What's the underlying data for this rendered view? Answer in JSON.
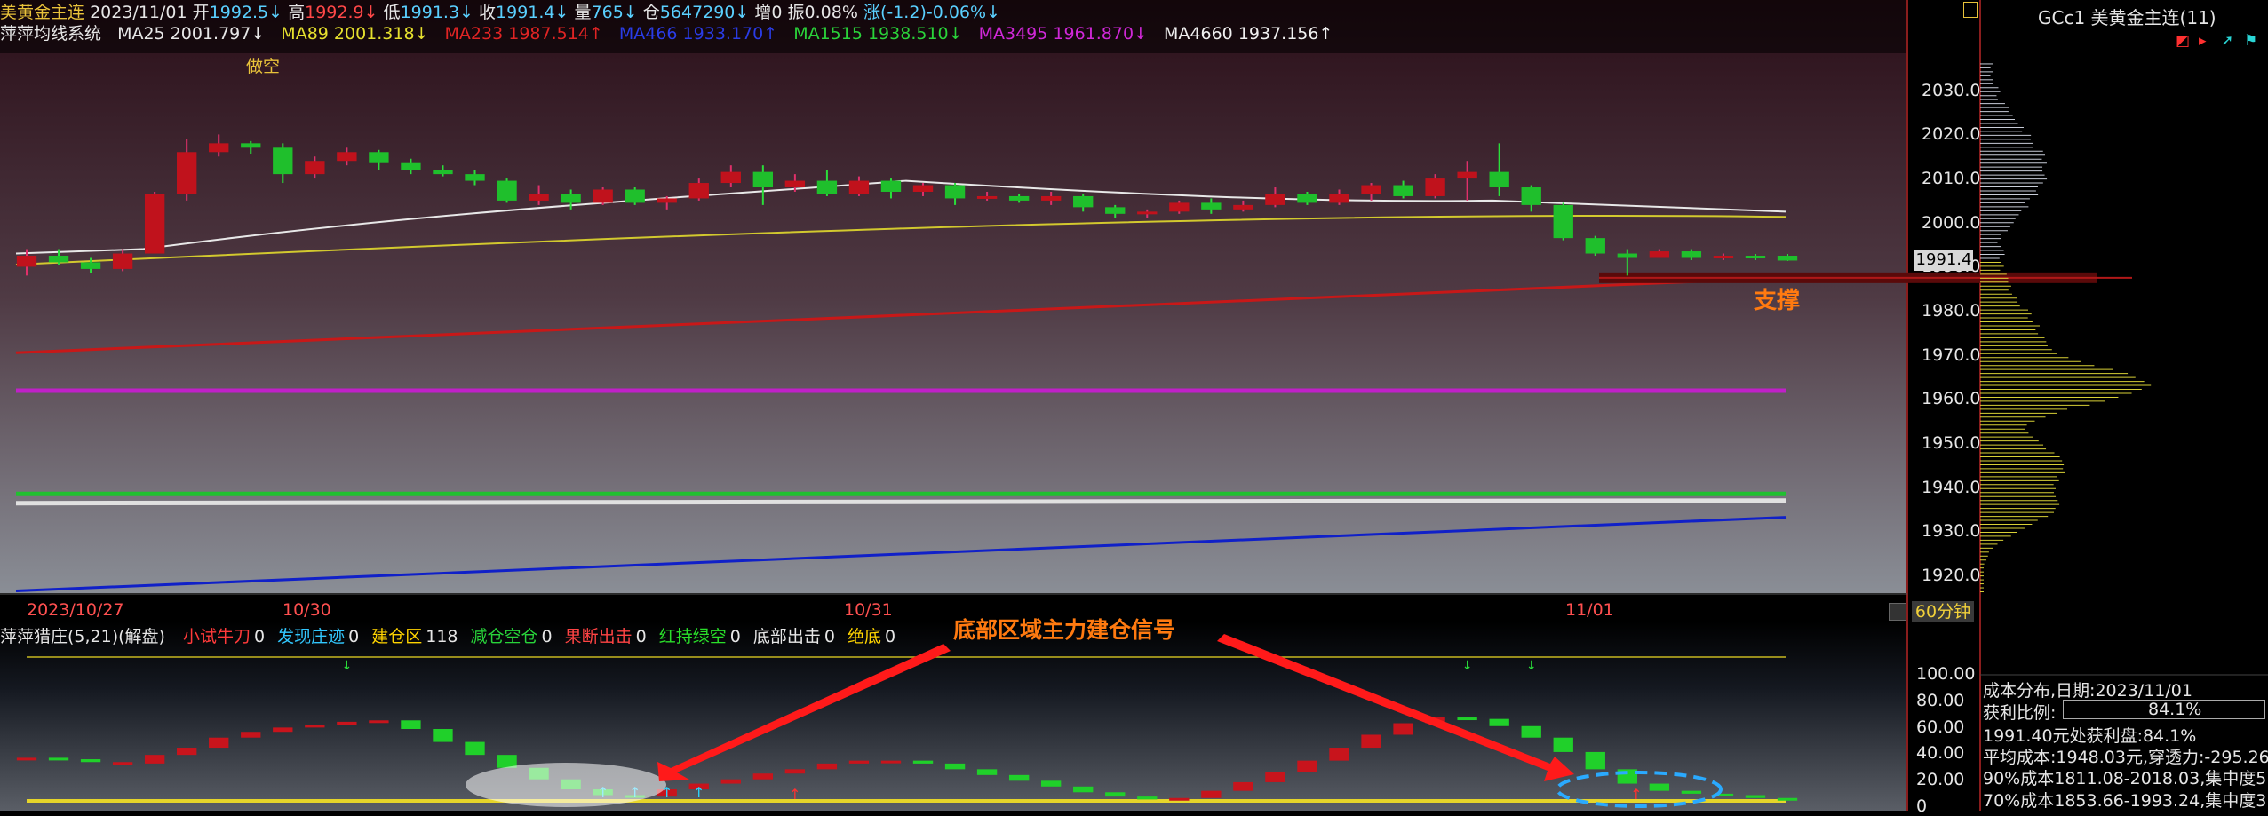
{
  "header": {
    "name": "美黄金主连",
    "date": "2023/11/01",
    "open_label": "开",
    "open": "1992.5",
    "high_label": "高",
    "high": "1992.9",
    "low_label": "低",
    "low": "1991.3",
    "close_label": "收",
    "close": "1991.4",
    "vol_label": "量",
    "vol": "765",
    "oi_label": "仓",
    "oi": "5647290",
    "inc_label": "增",
    "inc": "0",
    "amp_label": "振",
    "amp": "0.08%",
    "chg_label": "涨",
    "chg": "(-1.2)-0.06%",
    "arrow_down": "↓",
    "arrow_up": "↑"
  },
  "ma_line": {
    "title": "萍萍均线系统",
    "ma25": "MA25 2001.797↓",
    "ma89": "MA89 2001.318↓",
    "ma233": "MA233 1987.514↑",
    "ma466": "MA466 1933.170↑",
    "ma1515": "MA1515 1938.510↓",
    "ma3495": "MA3495 1961.870↓",
    "ma4660": "MA4660 1937.156↑"
  },
  "annotations": {
    "short": "做空",
    "support": "支撑",
    "signal": "底部区域主力建仓信号"
  },
  "price_axis": {
    "ticks": [
      "2030.0",
      "2020.0",
      "2010.0",
      "2000.0",
      "1990.0",
      "1980.0",
      "1970.0",
      "1960.0",
      "1950.0",
      "1940.0",
      "1930.0",
      "1920.0"
    ],
    "current": "1991.4"
  },
  "date_axis": {
    "labels": [
      "2023/10/27",
      "10/30",
      "10/31",
      "11/01"
    ],
    "period": "60分钟"
  },
  "indicator": {
    "title": "萍萍猎庄(5,21)(解盘)",
    "items": [
      {
        "label": "小试牛刀",
        "value": "0",
        "color": "#ff3a3a"
      },
      {
        "label": "发现庄迹",
        "value": "0",
        "color": "#32c8ff"
      },
      {
        "label": "建仓区",
        "value": "118",
        "color": "#ffd400"
      },
      {
        "label": "减仓空仓",
        "value": "0",
        "color": "#28d33a"
      },
      {
        "label": "果断出击",
        "value": "0",
        "color": "#ff4444"
      },
      {
        "label": "红持绿空",
        "value": "0",
        "color": "#2adf2a"
      },
      {
        "label": "底部出击",
        "value": "0",
        "color": "#e6e6e6"
      },
      {
        "label": "绝底",
        "value": "0",
        "color": "#ffd400"
      }
    ],
    "axis": [
      "100.00",
      "80.00",
      "60.00",
      "40.00",
      "20.00",
      "0"
    ]
  },
  "side_panel": {
    "title": "GCc1 美黄金主连(11)",
    "stats": [
      "成本分布,日期:2023/11/01",
      "获利比例:",
      "84.1%",
      "1991.40元处获利盘:84.1%",
      "平均成本:1948.03元,穿透力:-295.26",
      "90%成本1811.08-2018.03,集中度5.",
      "70%成本1853.66-1993.24,集中度3."
    ]
  },
  "colors": {
    "up": "#c0121c",
    "down": "#1fbf2c",
    "ma25": "#e8e8e8",
    "ma89": "#d2c92e",
    "ma233": "#c81818",
    "ma466": "#1020c8",
    "ma1515": "#20c030",
    "ma3495": "#c020c8",
    "ma4660": "#e0e0e0"
  },
  "chart_data": {
    "type": "candlestick",
    "x": [
      "10/27 a",
      "10/27 b",
      "10/27 c",
      "10/27 d",
      "10/30 a",
      "10/30 b",
      "10/30 c",
      "10/30 d",
      "10/30 e",
      "10/30 f",
      "10/30 g",
      "10/30 h",
      "10/30 i",
      "10/30 j",
      "10/30 k",
      "10/30 l",
      "10/30 m",
      "10/30 n",
      "10/30 o",
      "10/30 p",
      "10/30 q",
      "10/30 r",
      "10/30 s",
      "10/30 t",
      "10/31 a",
      "10/31 b",
      "10/31 c",
      "10/31 d",
      "10/31 e",
      "10/31 f",
      "10/31 g",
      "10/31 h",
      "10/31 i",
      "10/31 j",
      "10/31 k",
      "10/31 l",
      "10/31 m",
      "10/31 n",
      "10/31 o",
      "10/31 p",
      "10/31 q",
      "10/31 r",
      "10/31 s",
      "10/31 t",
      "10/31 u",
      "10/31 v",
      "11/01 a",
      "11/01 b",
      "11/01 c",
      "11/01 d",
      "11/01 e",
      "11/01 f",
      "11/01 g",
      "11/01 h",
      "11/01 i",
      "11/01 j"
    ],
    "candles": [
      [
        1990.0,
        1992.5,
        1988.0,
        1994.0
      ],
      [
        1992.5,
        1991.0,
        1990.5,
        1994.0
      ],
      [
        1991.0,
        1989.5,
        1988.5,
        1992.0
      ],
      [
        1989.5,
        1993.0,
        1989.0,
        1994.0
      ],
      [
        1993.0,
        2006.5,
        1993.0,
        2007.0
      ],
      [
        2006.5,
        2016.0,
        2005.0,
        2019.0
      ],
      [
        2016.0,
        2018.0,
        2015.0,
        2020.0
      ],
      [
        2018.0,
        2017.0,
        2015.5,
        2018.5
      ],
      [
        2017.0,
        2011.0,
        2009.0,
        2018.0
      ],
      [
        2011.0,
        2014.0,
        2010.0,
        2015.0
      ],
      [
        2014.0,
        2016.0,
        2013.0,
        2017.0
      ],
      [
        2016.0,
        2013.5,
        2012.0,
        2016.5
      ],
      [
        2013.5,
        2012.0,
        2011.0,
        2014.5
      ],
      [
        2012.0,
        2011.0,
        2010.5,
        2013.0
      ],
      [
        2011.0,
        2009.5,
        2008.5,
        2012.0
      ],
      [
        2009.5,
        2005.0,
        2004.5,
        2010.0
      ],
      [
        2005.0,
        2006.5,
        2004.0,
        2008.5
      ],
      [
        2006.5,
        2004.5,
        2003.0,
        2007.5
      ],
      [
        2004.5,
        2007.5,
        2004.0,
        2008.0
      ],
      [
        2007.5,
        2004.5,
        2004.0,
        2008.0
      ],
      [
        2004.5,
        2005.5,
        2003.0,
        2006.0
      ],
      [
        2005.5,
        2009.0,
        2005.0,
        2010.0
      ],
      [
        2009.0,
        2011.5,
        2008.0,
        2013.0
      ],
      [
        2011.5,
        2008.0,
        2004.0,
        2013.0
      ],
      [
        2008.0,
        2009.5,
        2007.0,
        2011.0
      ],
      [
        2009.5,
        2006.5,
        2006.0,
        2012.0
      ],
      [
        2006.5,
        2009.5,
        2006.0,
        2010.5
      ],
      [
        2009.5,
        2007.0,
        2005.5,
        2010.0
      ],
      [
        2007.0,
        2008.5,
        2006.0,
        2009.0
      ],
      [
        2008.5,
        2005.5,
        2004.0,
        2009.0
      ],
      [
        2005.5,
        2006.0,
        2005.0,
        2007.0
      ],
      [
        2006.0,
        2005.0,
        2004.5,
        2006.5
      ],
      [
        2005.0,
        2006.0,
        2004.0,
        2007.0
      ],
      [
        2006.0,
        2003.5,
        2002.5,
        2006.5
      ],
      [
        2003.5,
        2002.0,
        2001.0,
        2004.0
      ],
      [
        2002.0,
        2002.5,
        2001.0,
        2003.0
      ],
      [
        2002.5,
        2004.5,
        2002.0,
        2005.0
      ],
      [
        2004.5,
        2003.0,
        2002.0,
        2005.5
      ],
      [
        2003.0,
        2004.0,
        2002.5,
        2005.0
      ],
      [
        2004.0,
        2006.5,
        2003.5,
        2008.0
      ],
      [
        2006.5,
        2004.5,
        2004.0,
        2007.0
      ],
      [
        2004.5,
        2006.5,
        2004.0,
        2007.5
      ],
      [
        2006.5,
        2008.5,
        2005.0,
        2009.0
      ],
      [
        2008.5,
        2006.0,
        2005.5,
        2009.5
      ],
      [
        2006.0,
        2010.0,
        2005.5,
        2011.0
      ],
      [
        2010.0,
        2011.5,
        2005.0,
        2014.0
      ],
      [
        2011.5,
        2008.0,
        2006.0,
        2018.0
      ],
      [
        2008.0,
        2004.0,
        2002.5,
        2008.5
      ],
      [
        2004.0,
        1996.5,
        1996.0,
        2004.5
      ],
      [
        1996.5,
        1993.0,
        1992.5,
        1997.0
      ],
      [
        1993.0,
        1992.0,
        1988.0,
        1994.0
      ],
      [
        1992.0,
        1993.5,
        1992.0,
        1994.0
      ],
      [
        1993.5,
        1992.0,
        1991.5,
        1994.0
      ],
      [
        1992.0,
        1992.5,
        1991.5,
        1993.0
      ],
      [
        1992.5,
        1992.0,
        1991.5,
        1992.9
      ],
      [
        1992.5,
        1991.4,
        1991.3,
        1992.9
      ]
    ],
    "ylim": [
      1916,
      2038
    ],
    "ma": {
      "ma25_start": 1993.0,
      "ma25_peak": 2009.5,
      "ma25_end": 2002.5,
      "ma89_start": 1990.5,
      "ma89_end": 2001.3,
      "ma233_start": 1970.5,
      "ma233_end": 1987.5,
      "ma3495": 1961.9,
      "ma1515": 1938.5,
      "ma4660": 1937.2,
      "ma466_start": 1916.5,
      "ma466_end": 1933.2
    },
    "support": 1987.5,
    "indicator_values": [
      30,
      29,
      27,
      26,
      32,
      37,
      44,
      48,
      51,
      53,
      55,
      56,
      50,
      41,
      32,
      23,
      15,
      8,
      4,
      3,
      8,
      12,
      15,
      19,
      22,
      26,
      28,
      28,
      26,
      22,
      18,
      14,
      10,
      6,
      3,
      1,
      2,
      7,
      13,
      20,
      28,
      37,
      46,
      54,
      58,
      57,
      52,
      44,
      34,
      22,
      12,
      7,
      5,
      4,
      2,
      1
    ],
    "indicator_up": [
      true,
      false,
      false,
      true,
      true,
      true,
      true,
      true,
      true,
      true,
      true,
      true,
      false,
      false,
      false,
      false,
      false,
      false,
      false,
      false,
      true,
      true,
      true,
      true,
      true,
      true,
      true,
      true,
      false,
      false,
      false,
      false,
      false,
      false,
      false,
      false,
      true,
      true,
      true,
      true,
      true,
      true,
      true,
      true,
      true,
      false,
      false,
      false,
      false,
      false,
      false,
      false,
      false,
      false,
      false,
      false
    ],
    "profile_peak": 1963.0
  }
}
